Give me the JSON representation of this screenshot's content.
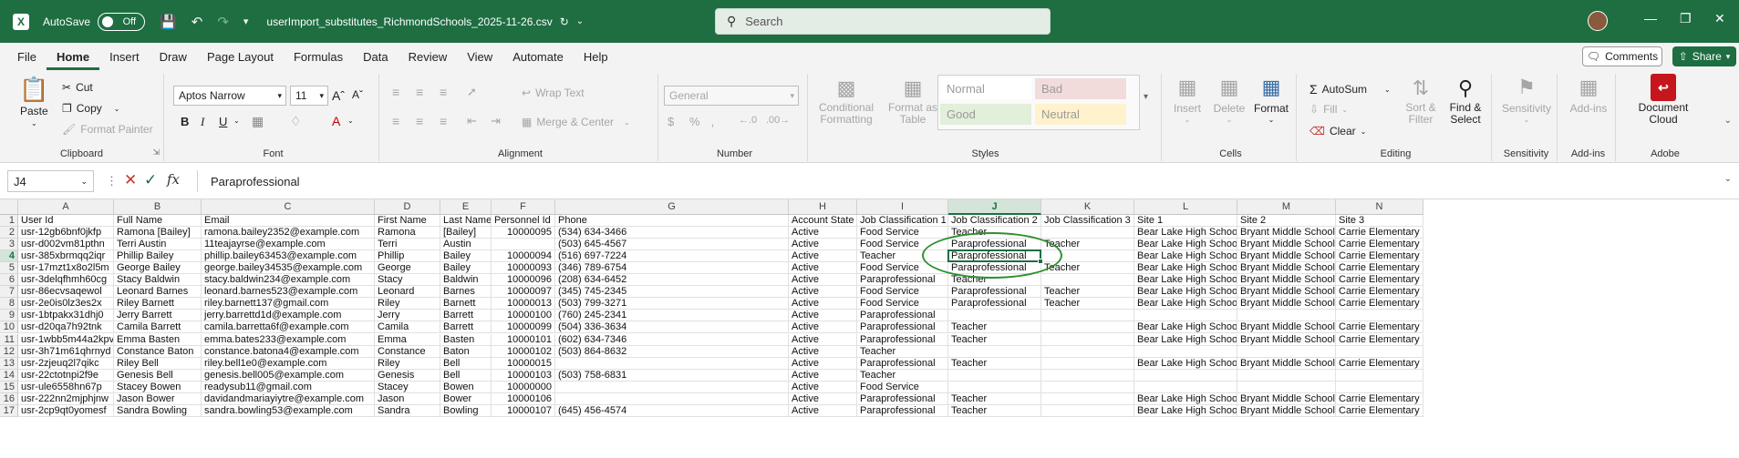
{
  "title_bar": {
    "app_icon_letter": "X",
    "autosave_label": "AutoSave",
    "autosave_state": "Off",
    "filename": "userImport_substitutes_RichmondSchools_2025-11-26.csv",
    "search_placeholder": "Search"
  },
  "menu": {
    "items": [
      "File",
      "Home",
      "Insert",
      "Draw",
      "Page Layout",
      "Formulas",
      "Data",
      "Review",
      "View",
      "Automate",
      "Help"
    ],
    "active": "Home",
    "comments_label": "Comments",
    "share_label": "Share"
  },
  "ribbon": {
    "clipboard": {
      "paste": "Paste",
      "cut": "Cut",
      "copy": "Copy",
      "format_painter": "Format Painter",
      "label": "Clipboard"
    },
    "font": {
      "name": "Aptos Narrow",
      "size": "11",
      "label": "Font"
    },
    "alignment": {
      "wrap_text": "Wrap Text",
      "merge_center": "Merge & Center",
      "label": "Alignment"
    },
    "number": {
      "format": "General",
      "label": "Number"
    },
    "styles": {
      "conditional": "Conditional Formatting",
      "format_as_table": "Format as Table",
      "normal": "Normal",
      "bad": "Bad",
      "good": "Good",
      "neutral": "Neutral",
      "label": "Styles"
    },
    "cells": {
      "insert": "Insert",
      "delete": "Delete",
      "format": "Format",
      "label": "Cells"
    },
    "editing": {
      "autosum": "AutoSum",
      "fill": "Fill",
      "clear": "Clear",
      "sort_filter": "Sort & Filter",
      "find_select": "Find & Select",
      "label": "Editing"
    },
    "sensitivity": {
      "button": "Sensitivity",
      "label": "Sensitivity"
    },
    "addins": {
      "button": "Add-ins",
      "label": "Add-ins"
    },
    "adobe": {
      "button": "Document Cloud",
      "label": "Adobe"
    }
  },
  "formula_bar": {
    "name_box": "J4",
    "value": "Paraprofessional"
  },
  "sheet": {
    "columns": [
      "A",
      "B",
      "C",
      "D",
      "E",
      "F",
      "G",
      "H",
      "I",
      "J",
      "K",
      "L",
      "M",
      "N"
    ],
    "selected_column": "J",
    "selected_row": "4",
    "row_numbers": [
      "1",
      "2",
      "3",
      "4",
      "5",
      "6",
      "7",
      "8",
      "9",
      "10",
      "11",
      "12",
      "13",
      "14",
      "15",
      "16",
      "17"
    ],
    "rows": [
      [
        "User Id",
        "Full Name",
        "Email",
        "First Name",
        "Last Name",
        "Personnel Id",
        "Phone",
        "Account State",
        "Job Classification 1",
        "Job Classification 2",
        "Job Classification 3",
        "Site 1",
        "Site 2",
        "Site 3"
      ],
      [
        "usr-12gb6bnf0jkfp",
        "Ramona [Bailey]",
        "ramona.bailey2352@example.com",
        "Ramona",
        "[Bailey]",
        "10000095",
        "(534) 634-3466",
        "Active",
        "Food Service",
        "Teacher",
        "",
        "Bear Lake High School",
        "Bryant Middle School",
        "Carrie Elementary"
      ],
      [
        "usr-d002vm81pthn",
        "Terri Austin",
        "11teajayrse@example.com",
        "Terri",
        "Austin",
        "",
        "(503) 645-4567",
        "Active",
        "Food Service",
        "Paraprofessional",
        "Teacher",
        "Bear Lake High School",
        "Bryant Middle School",
        "Carrie Elementary"
      ],
      [
        "usr-385xbrmqq2iqr",
        "Phillip Bailey",
        "phillip.bailey63453@example.com",
        "Phillip",
        "Bailey",
        "10000094",
        "(516) 697-7224",
        "Active",
        "Teacher",
        "Paraprofessional",
        "",
        "Bear Lake High School",
        "Bryant Middle School",
        "Carrie Elementary"
      ],
      [
        "usr-17mzt1x8o2l5m",
        "George Bailey",
        "george.bailey34535@example.com",
        "George",
        "Bailey",
        "10000093",
        "(346) 789-6754",
        "Active",
        "Food Service",
        "Paraprofessional",
        "Teacher",
        "Bear Lake High School",
        "Bryant Middle School",
        "Carrie Elementary"
      ],
      [
        "usr-3delqfhmh60cg",
        "Stacy Baldwin",
        "stacy.baldwin234@example.com",
        "Stacy",
        "Baldwin",
        "10000096",
        "(208) 634-6452",
        "Active",
        "Paraprofessional",
        "Teacher",
        "",
        "Bear Lake High School",
        "Bryant Middle School",
        "Carrie Elementary"
      ],
      [
        "usr-86ecvsaqewol",
        "Leonard Barnes",
        "leonard.barnes523@example.com",
        "Leonard",
        "Barnes",
        "10000097",
        "(345) 745-2345",
        "Active",
        "Food Service",
        "Paraprofessional",
        "Teacher",
        "Bear Lake High School",
        "Bryant Middle School",
        "Carrie Elementary"
      ],
      [
        "usr-2e0is0lz3es2x",
        "Riley Barnett",
        "riley.barnett137@gmail.com",
        "Riley",
        "Barnett",
        "10000013",
        "(503) 799-3271",
        "Active",
        "Food Service",
        "Paraprofessional",
        "Teacher",
        "Bear Lake High School",
        "Bryant Middle School",
        "Carrie Elementary"
      ],
      [
        "usr-1btpakx31dhj0",
        "Jerry Barrett",
        "jerry.barrettd1d@example.com",
        "Jerry",
        "Barrett",
        "10000100",
        "(760) 245-2341",
        "Active",
        "Paraprofessional",
        "",
        "",
        "",
        "",
        ""
      ],
      [
        "usr-d20qa7h92tnk",
        "Camila Barrett",
        "camila.barretta6f@example.com",
        "Camila",
        "Barrett",
        "10000099",
        "(504) 336-3634",
        "Active",
        "Paraprofessional",
        "Teacher",
        "",
        "Bear Lake High School",
        "Bryant Middle School",
        "Carrie Elementary"
      ],
      [
        "usr-1wbb5m44a2kpv",
        "Emma Basten",
        "emma.bates233@example.com",
        "Emma",
        "Basten",
        "10000101",
        "(602) 634-7346",
        "Active",
        "Paraprofessional",
        "Teacher",
        "",
        "Bear Lake High School",
        "Bryant Middle School",
        "Carrie Elementary"
      ],
      [
        "usr-3h71m61qhrnyd",
        "Constance Baton",
        "constance.batona4@example.com",
        "Constance",
        "Baton",
        "10000102",
        "(503) 864-8632",
        "Active",
        "Teacher",
        "",
        "",
        "",
        "",
        ""
      ],
      [
        "usr-2zjeuq2l7qikc",
        "Riley Bell",
        "riley.bell1e0@example.com",
        "Riley",
        "Bell",
        "10000015",
        "",
        "Active",
        "Paraprofessional",
        "Teacher",
        "",
        "Bear Lake High School",
        "Bryant Middle School",
        "Carrie Elementary"
      ],
      [
        "usr-22ctotnpi2f9e",
        "Genesis Bell",
        "genesis.bell005@example.com",
        "Genesis",
        "Bell",
        "10000103",
        "(503) 758-6831",
        "Active",
        "Teacher",
        "",
        "",
        "",
        "",
        ""
      ],
      [
        "usr-ule6558hn67p",
        "Stacey Bowen",
        "readysub11@gmail.com",
        "Stacey",
        "Bowen",
        "10000000",
        "",
        "Active",
        "Food Service",
        "",
        "",
        "",
        "",
        ""
      ],
      [
        "usr-222nn2mjphjnw",
        "Jason Bower",
        "davidandmariayiytre@example.com",
        "Jason",
        "Bower",
        "10000106",
        "",
        "Active",
        "Paraprofessional",
        "Teacher",
        "",
        "Bear Lake High School",
        "Bryant Middle School",
        "Carrie Elementary"
      ],
      [
        "usr-2cp9qt0yomesf",
        "Sandra Bowling",
        "sandra.bowling53@example.com",
        "Sandra",
        "Bowling",
        "10000107",
        "(645) 456-4574",
        "Active",
        "Paraprofessional",
        "Teacher",
        "",
        "Bear Lake High School",
        "Bryant Middle School",
        "Carrie Elementary"
      ]
    ]
  }
}
